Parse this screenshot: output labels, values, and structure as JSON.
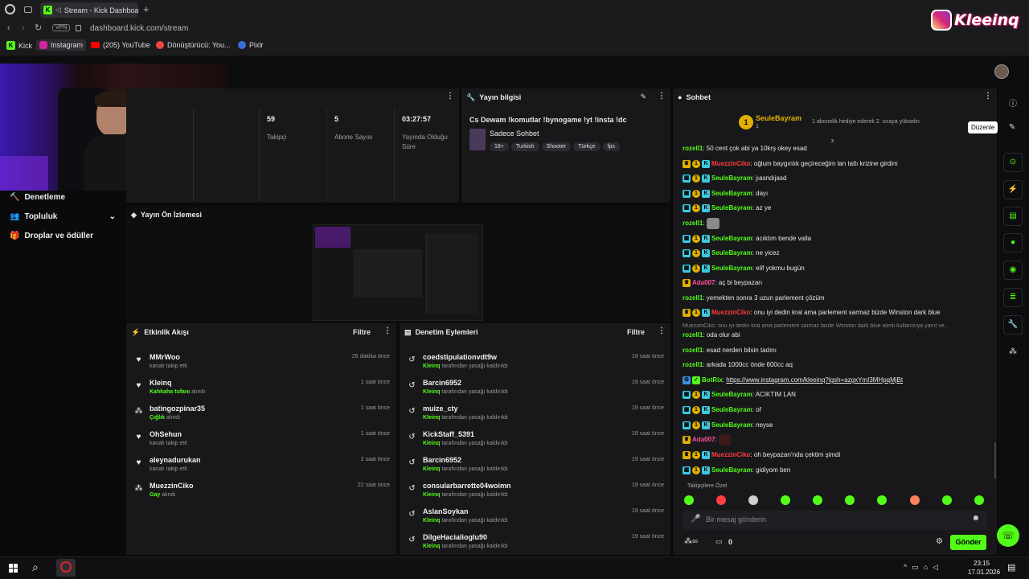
{
  "browser": {
    "tab_title": "Stream - Kick Dashboa",
    "url": "dashboard.kick.com/stream",
    "vpn": "VPN",
    "bookmarks": [
      "Kick",
      "Instagram",
      "(205) YouTube",
      "Dönüştürücü: You...",
      "Pixlr"
    ]
  },
  "watermark": {
    "text": "Kleeinq"
  },
  "nav": {
    "items": [
      {
        "label": "Denetleme"
      },
      {
        "label": "Topluluk"
      },
      {
        "label": "Droplar ve ödüller"
      }
    ]
  },
  "stats": [
    {
      "value": "59",
      "label": "Takipçi"
    },
    {
      "value": "5",
      "label": "Abone Sayısı"
    },
    {
      "value": "03:27:57",
      "label": "Yayında Olduğu Süre"
    }
  ],
  "stream_info": {
    "title": "Yayın bilgisi",
    "stream_title": "Cs Dewam !komutlar !bynogame !yt !insta !dc",
    "category": "Sadece Sohbet",
    "tags": [
      "18+",
      "Turkish",
      "Shooter",
      "Türkçe",
      "fps"
    ]
  },
  "preview": {
    "title": "Yayın Ön İzlemesi"
  },
  "activity": {
    "title": "Etkinlik Akışı",
    "filter": "Filtre",
    "items": [
      {
        "icon": "heart-icon",
        "name": "MMrWoo",
        "sub": "kanalı takip etti",
        "hl": "",
        "time": "26 dakika önce"
      },
      {
        "icon": "heart-icon",
        "name": "Kleinq",
        "hl": "Kahkaha tufanı",
        "sub": "alındı",
        "time": "1 saat önce"
      },
      {
        "icon": "points-icon",
        "name": "batingozpinar35",
        "hl": "Çığlık",
        "sub": "alındı",
        "time": "1 saat önce"
      },
      {
        "icon": "heart-icon",
        "name": "OhSehun",
        "sub": "kanalı takip etti",
        "hl": "",
        "time": "1 saat önce"
      },
      {
        "icon": "heart-icon",
        "name": "aleynadurukan",
        "sub": "kanalı takip etti",
        "hl": "",
        "time": "2 saat önce"
      },
      {
        "icon": "points-icon",
        "name": "MuezzinCiko",
        "hl": "Gay",
        "sub": "alındı",
        "time": "22 saat önce"
      }
    ]
  },
  "moderation": {
    "title": "Denetim Eylemleri",
    "filter": "Filtre",
    "by": "Kleinq",
    "action": "tarafından yasağı kaldırıldı",
    "items": [
      {
        "name": "coedstipulationvdt9w",
        "time": "19 saat önce"
      },
      {
        "name": "Barcin6952",
        "time": "19 saat önce"
      },
      {
        "name": "muize_cty",
        "time": "19 saat önce"
      },
      {
        "name": "KickStaff_5391",
        "time": "19 saat önce"
      },
      {
        "name": "Barcin6952",
        "time": "19 saat önce"
      },
      {
        "name": "consularbarrette04woimn",
        "time": "19 saat önce"
      },
      {
        "name": "AslanSoykan",
        "time": "19 saat önce"
      },
      {
        "name": "DilgeHacialioglu90",
        "time": "19 saat önce"
      }
    ]
  },
  "chat": {
    "title": "Sohbet",
    "pinned_user": "SeuleBayram",
    "pinned_count": "1",
    "pinned_note": "1 abonelik hediye ederek 2. sıraya yükselin",
    "tooltip": "Düzenle",
    "reply_hint": "MuezzinCiko: onu iyi dedin kral ama parlement sarmaz bizde Winston dark blue isimli kullanıcıya yanıt ve...",
    "followers_only": "Takipçilere Özel",
    "placeholder": "Bir mesaj gönderin",
    "points": "0",
    "send": "Gönder",
    "colors": {
      "green": "#53fc18",
      "pink": "#ff4fa0",
      "red": "#ff3b3b",
      "orange": "#ff7a59"
    },
    "messages": [
      {
        "user": "rozell1",
        "color": "green",
        "badges": [],
        "text": "50 cent çok abi ya 10krş okey esad"
      },
      {
        "user": "MuezzinCiko",
        "color": "red",
        "badges": [
          "crown",
          "sub",
          "kick"
        ],
        "text": "oğlum baygınlık geçireceğim lan tatlı krizine girdim"
      },
      {
        "user": "SeuleBayram",
        "color": "green",
        "badges": [
          "gift",
          "sub",
          "kick"
        ],
        "text": "jıasndıjasd"
      },
      {
        "user": "SeuleBayram",
        "color": "green",
        "badges": [
          "gift",
          "sub",
          "kick"
        ],
        "text": "dayı"
      },
      {
        "user": "SeuleBayram",
        "color": "green",
        "badges": [
          "gift",
          "sub",
          "kick"
        ],
        "text": "az ye"
      },
      {
        "user": "rozell1",
        "color": "green",
        "badges": [],
        "text": ""
      },
      {
        "user": "SeuleBayram",
        "color": "green",
        "badges": [
          "gift",
          "sub",
          "kick"
        ],
        "text": "acıktım bende valla"
      },
      {
        "user": "SeuleBayram",
        "color": "green",
        "badges": [
          "gift",
          "sub",
          "kick"
        ],
        "text": "ne yicez"
      },
      {
        "user": "SeuleBayram",
        "color": "green",
        "badges": [
          "gift",
          "sub",
          "kick"
        ],
        "text": "elif yokmu bugün"
      },
      {
        "user": "Ada007",
        "color": "pink",
        "badges": [
          "crown"
        ],
        "text": "aç bi beypazarı"
      },
      {
        "user": "rozell1",
        "color": "green",
        "badges": [],
        "text": "yemekten sonra 3 uzun parlement çözüm"
      },
      {
        "user": "MuezzinCiko",
        "color": "red",
        "badges": [
          "crown",
          "sub",
          "kick"
        ],
        "text": "onu iyi dedin kral ama parlement sarmaz bizde Winston dark blue"
      },
      {
        "user": "rozell1",
        "color": "green",
        "badges": [],
        "text": "oda olur abi"
      },
      {
        "user": "rozell1",
        "color": "green",
        "badges": [],
        "text": "esad nerden bilsin tadını"
      },
      {
        "user": "rozell1",
        "color": "green",
        "badges": [],
        "text": "arkada 1000cc önde 600cc aq"
      },
      {
        "user": "BotRix",
        "color": "green",
        "badges": [
          "bot",
          "verified"
        ],
        "text": "https://www.instagram.com/kleeinq?igsh=azgxYmI3MHpqMjBt"
      },
      {
        "user": "SeuleBayram",
        "color": "green",
        "badges": [
          "gift",
          "sub",
          "kick"
        ],
        "text": "ACIKTIM LAN"
      },
      {
        "user": "SeuleBayram",
        "color": "green",
        "badges": [
          "gift",
          "sub",
          "kick"
        ],
        "text": "of"
      },
      {
        "user": "SeuleBayram",
        "color": "green",
        "badges": [
          "gift",
          "sub",
          "kick"
        ],
        "text": "neyse"
      },
      {
        "user": "Ada007",
        "color": "pink",
        "badges": [
          "crown"
        ],
        "text": ""
      },
      {
        "user": "MuezzinCiko",
        "color": "red",
        "badges": [
          "crown",
          "sub",
          "kick"
        ],
        "text": "oh beypazarı'nda çektim şimdi"
      },
      {
        "user": "SeuleBayram",
        "color": "green",
        "badges": [
          "gift",
          "sub",
          "kick"
        ],
        "text": "gidiyom ben"
      }
    ]
  },
  "taskbar": {
    "time": "23:15",
    "date": "17.01.2026"
  }
}
